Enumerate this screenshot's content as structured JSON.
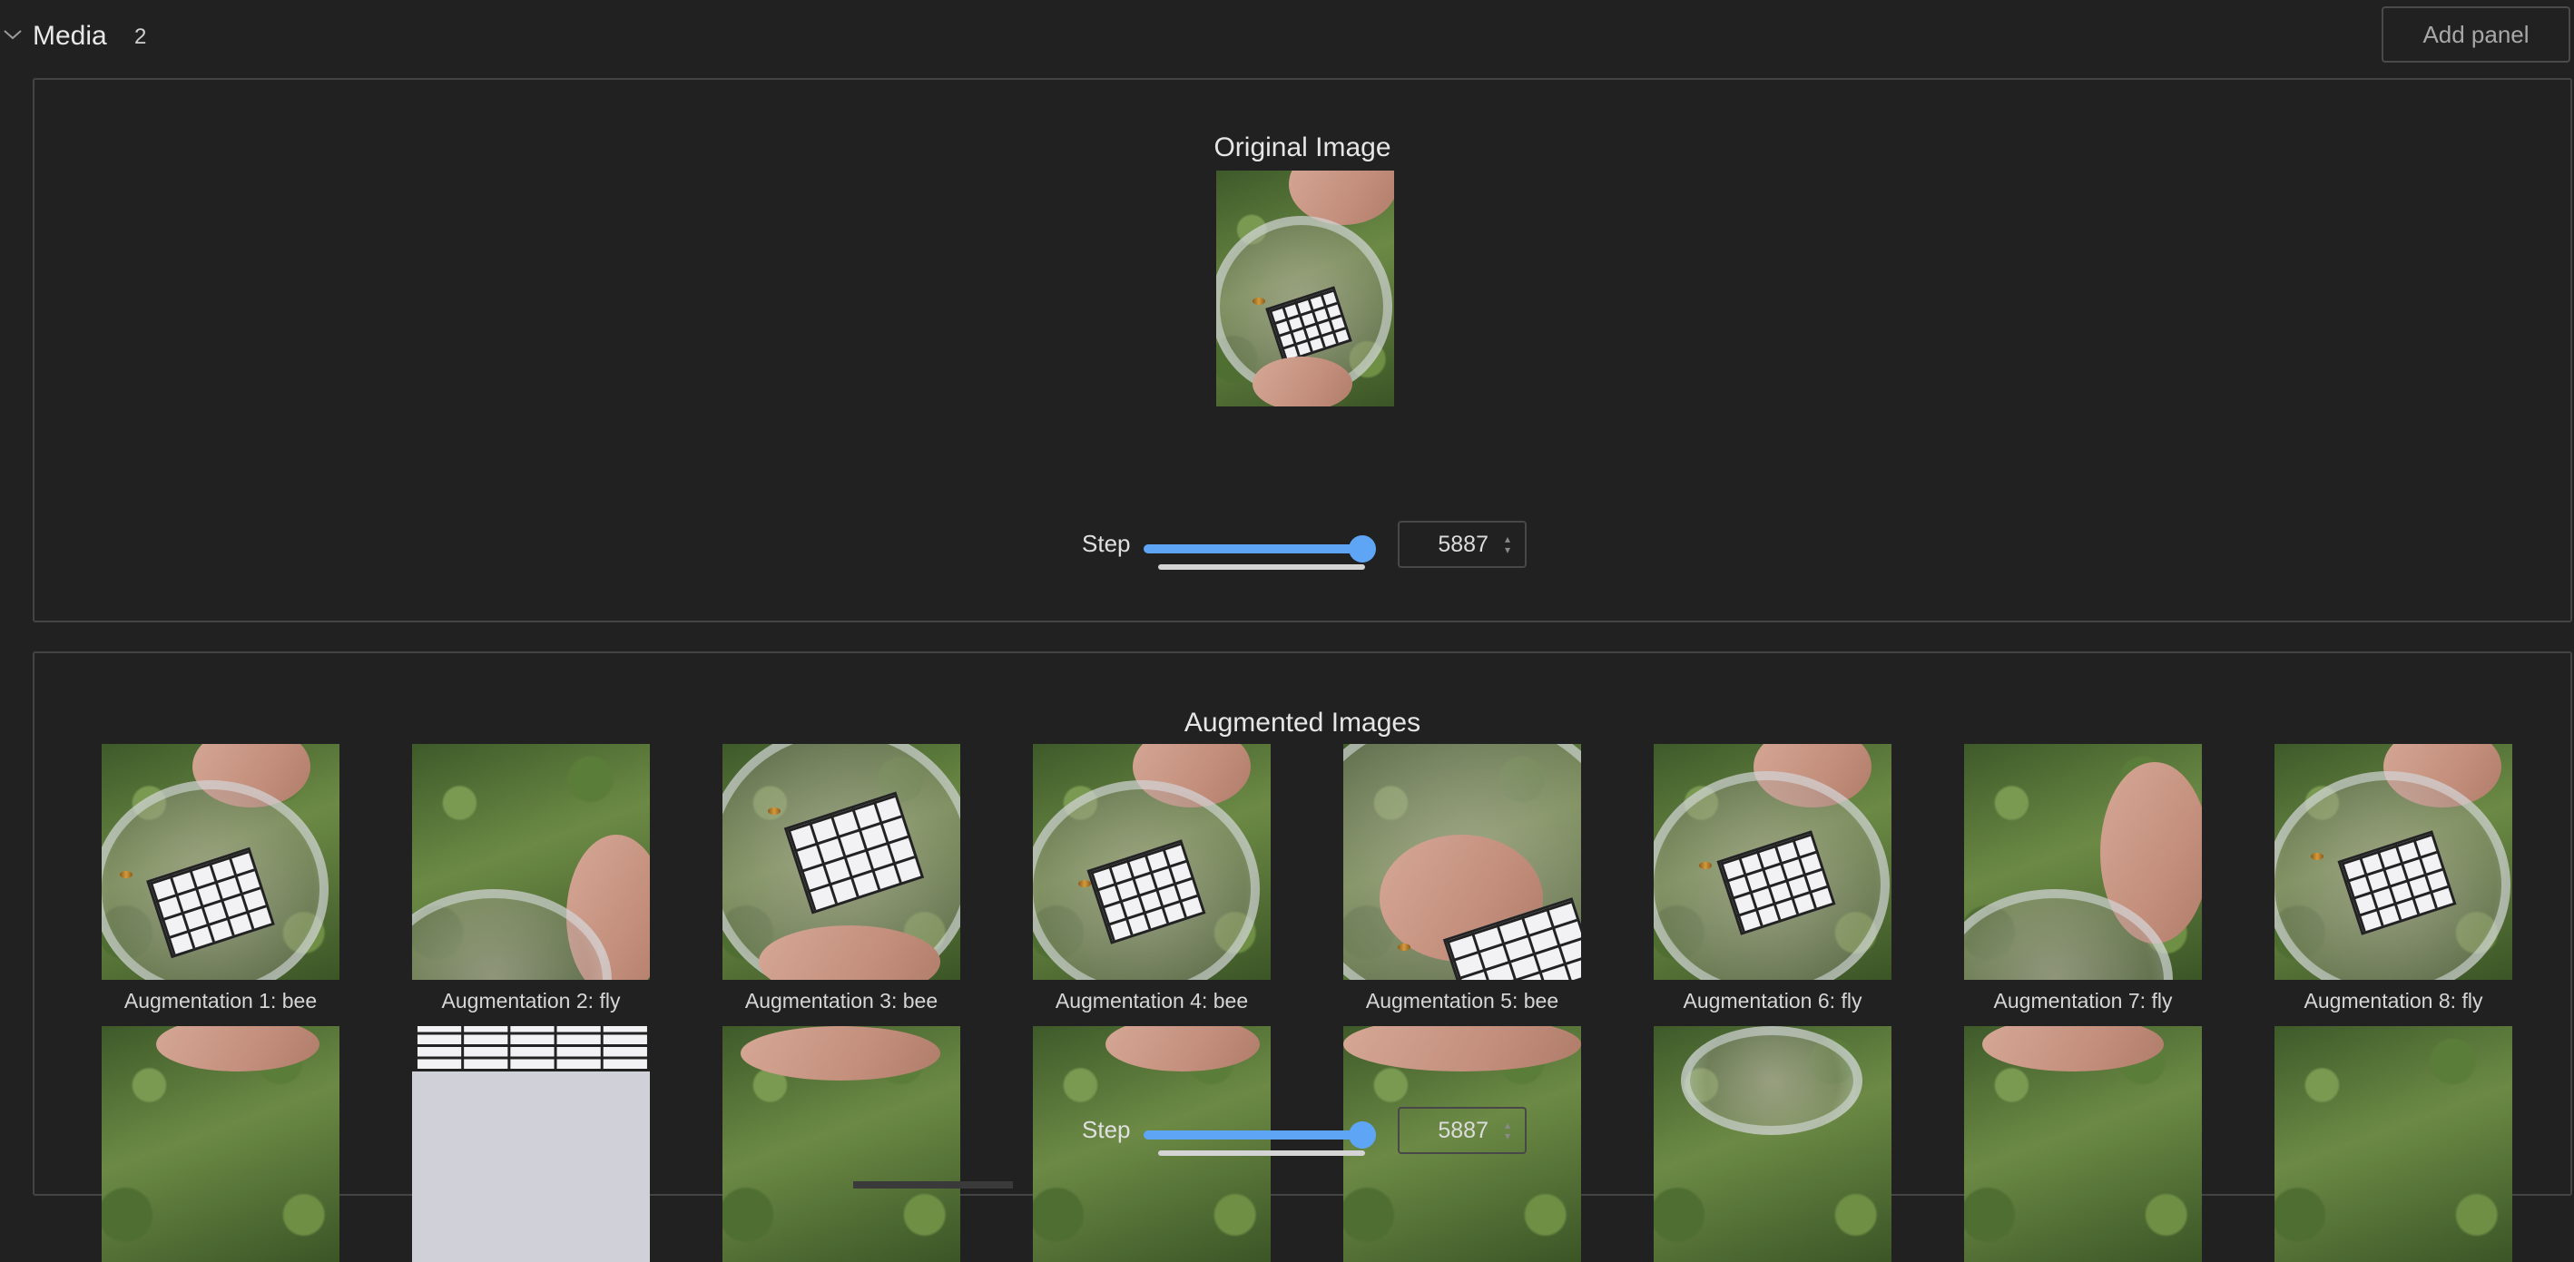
{
  "section": {
    "title": "Media",
    "count": "2",
    "add_panel_label": "Add panel"
  },
  "panels": [
    {
      "title": "Original Image",
      "step_label": "Step",
      "step_value": "5887"
    },
    {
      "title": "Augmented Images",
      "step_label": "Step",
      "step_value": "5887",
      "captions": [
        "Augmentation 1: bee",
        "Augmentation 2: fly",
        "Augmentation 3: bee",
        "Augmentation 4: bee",
        "Augmentation 5: bee",
        "Augmentation 6: fly",
        "Augmentation 7: fly",
        "Augmentation 8: fly"
      ]
    }
  ],
  "colors": {
    "background": "#212121",
    "panel_border": "#444444",
    "accent": "#5ea6f5",
    "text": "#e6e6e6"
  },
  "icons": [
    "chevron-down-icon",
    "spinner-arrows-icon"
  ]
}
